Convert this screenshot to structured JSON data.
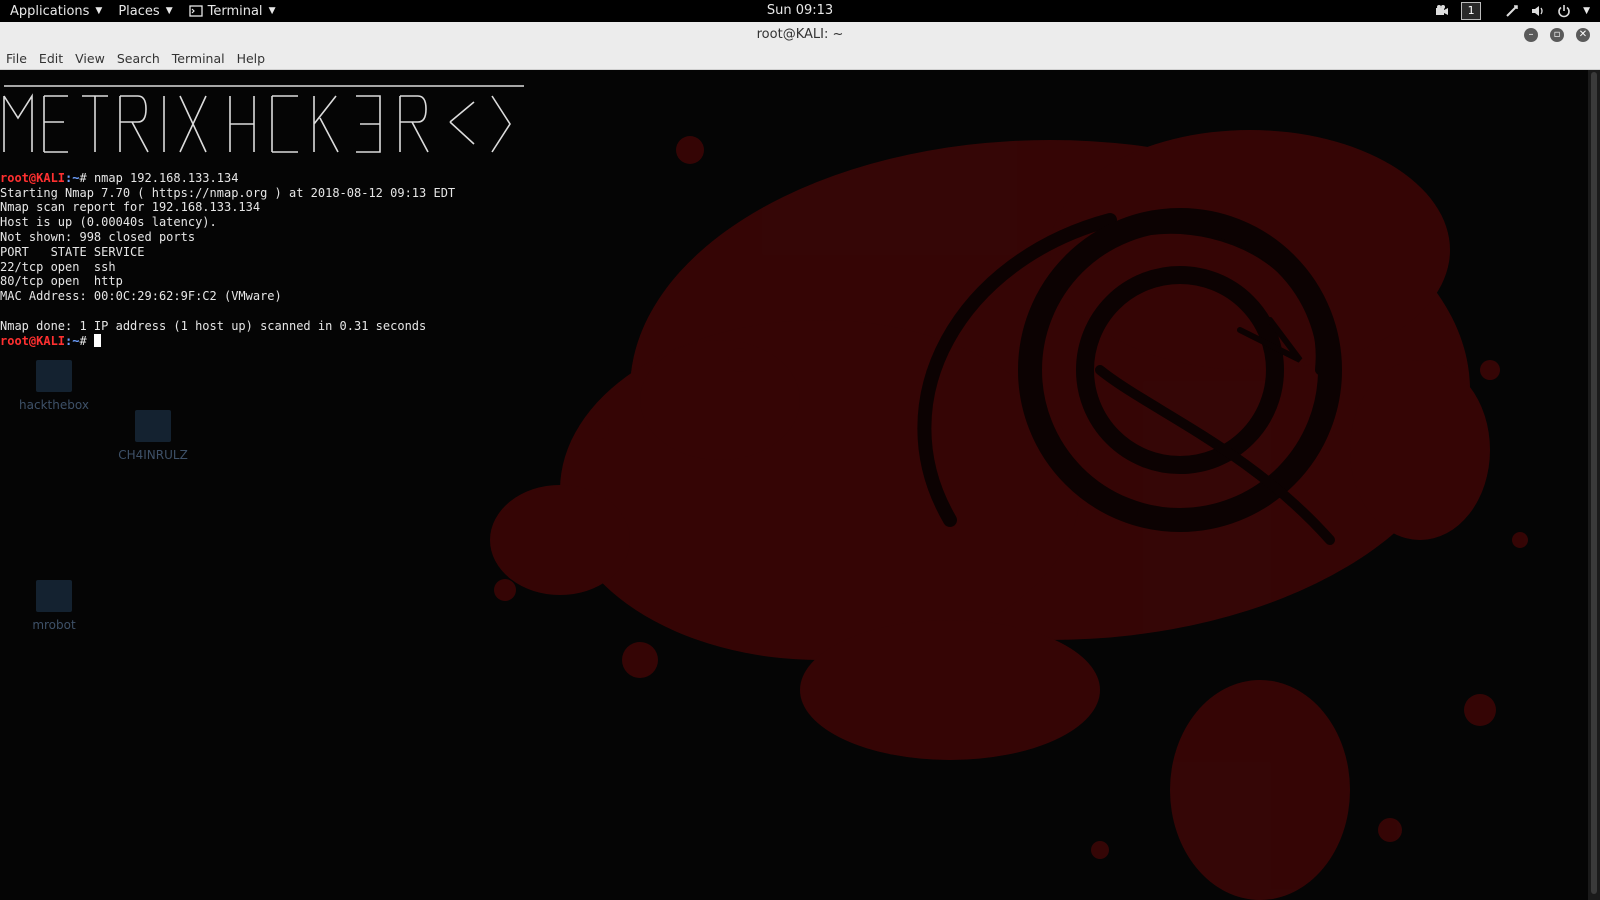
{
  "panel": {
    "applications": "Applications",
    "places": "Places",
    "terminal": "Terminal",
    "clock": "Sun 09:13",
    "workspace": "1"
  },
  "window": {
    "title": "root@KALI: ~",
    "menu": [
      "File",
      "Edit",
      "View",
      "Search",
      "Terminal",
      "Help"
    ]
  },
  "prompt": {
    "user": "root@KALI",
    "path": ":~",
    "symbol": "# "
  },
  "terminal": {
    "command": "nmap 192.168.133.134",
    "output": [
      "Starting Nmap 7.70 ( https://nmap.org ) at 2018-08-12 09:13 EDT",
      "Nmap scan report for 192.168.133.134",
      "Host is up (0.00040s latency).",
      "Not shown: 998 closed ports",
      "PORT   STATE SERVICE",
      "22/tcp open  ssh",
      "80/tcp open  http",
      "MAC Address: 00:0C:29:62:9F:C2 (VMware)",
      "",
      "Nmap done: 1 IP address (1 host up) scanned in 0.31 seconds"
    ]
  },
  "desktop_icons": [
    "hackthebox",
    "mrobot",
    "CH4INRULZ"
  ],
  "colors": {
    "prompt_user": "#ff3030",
    "prompt_path": "#6ea0ff",
    "splatter": "#3a0707",
    "terminal_bg": "#050505"
  }
}
